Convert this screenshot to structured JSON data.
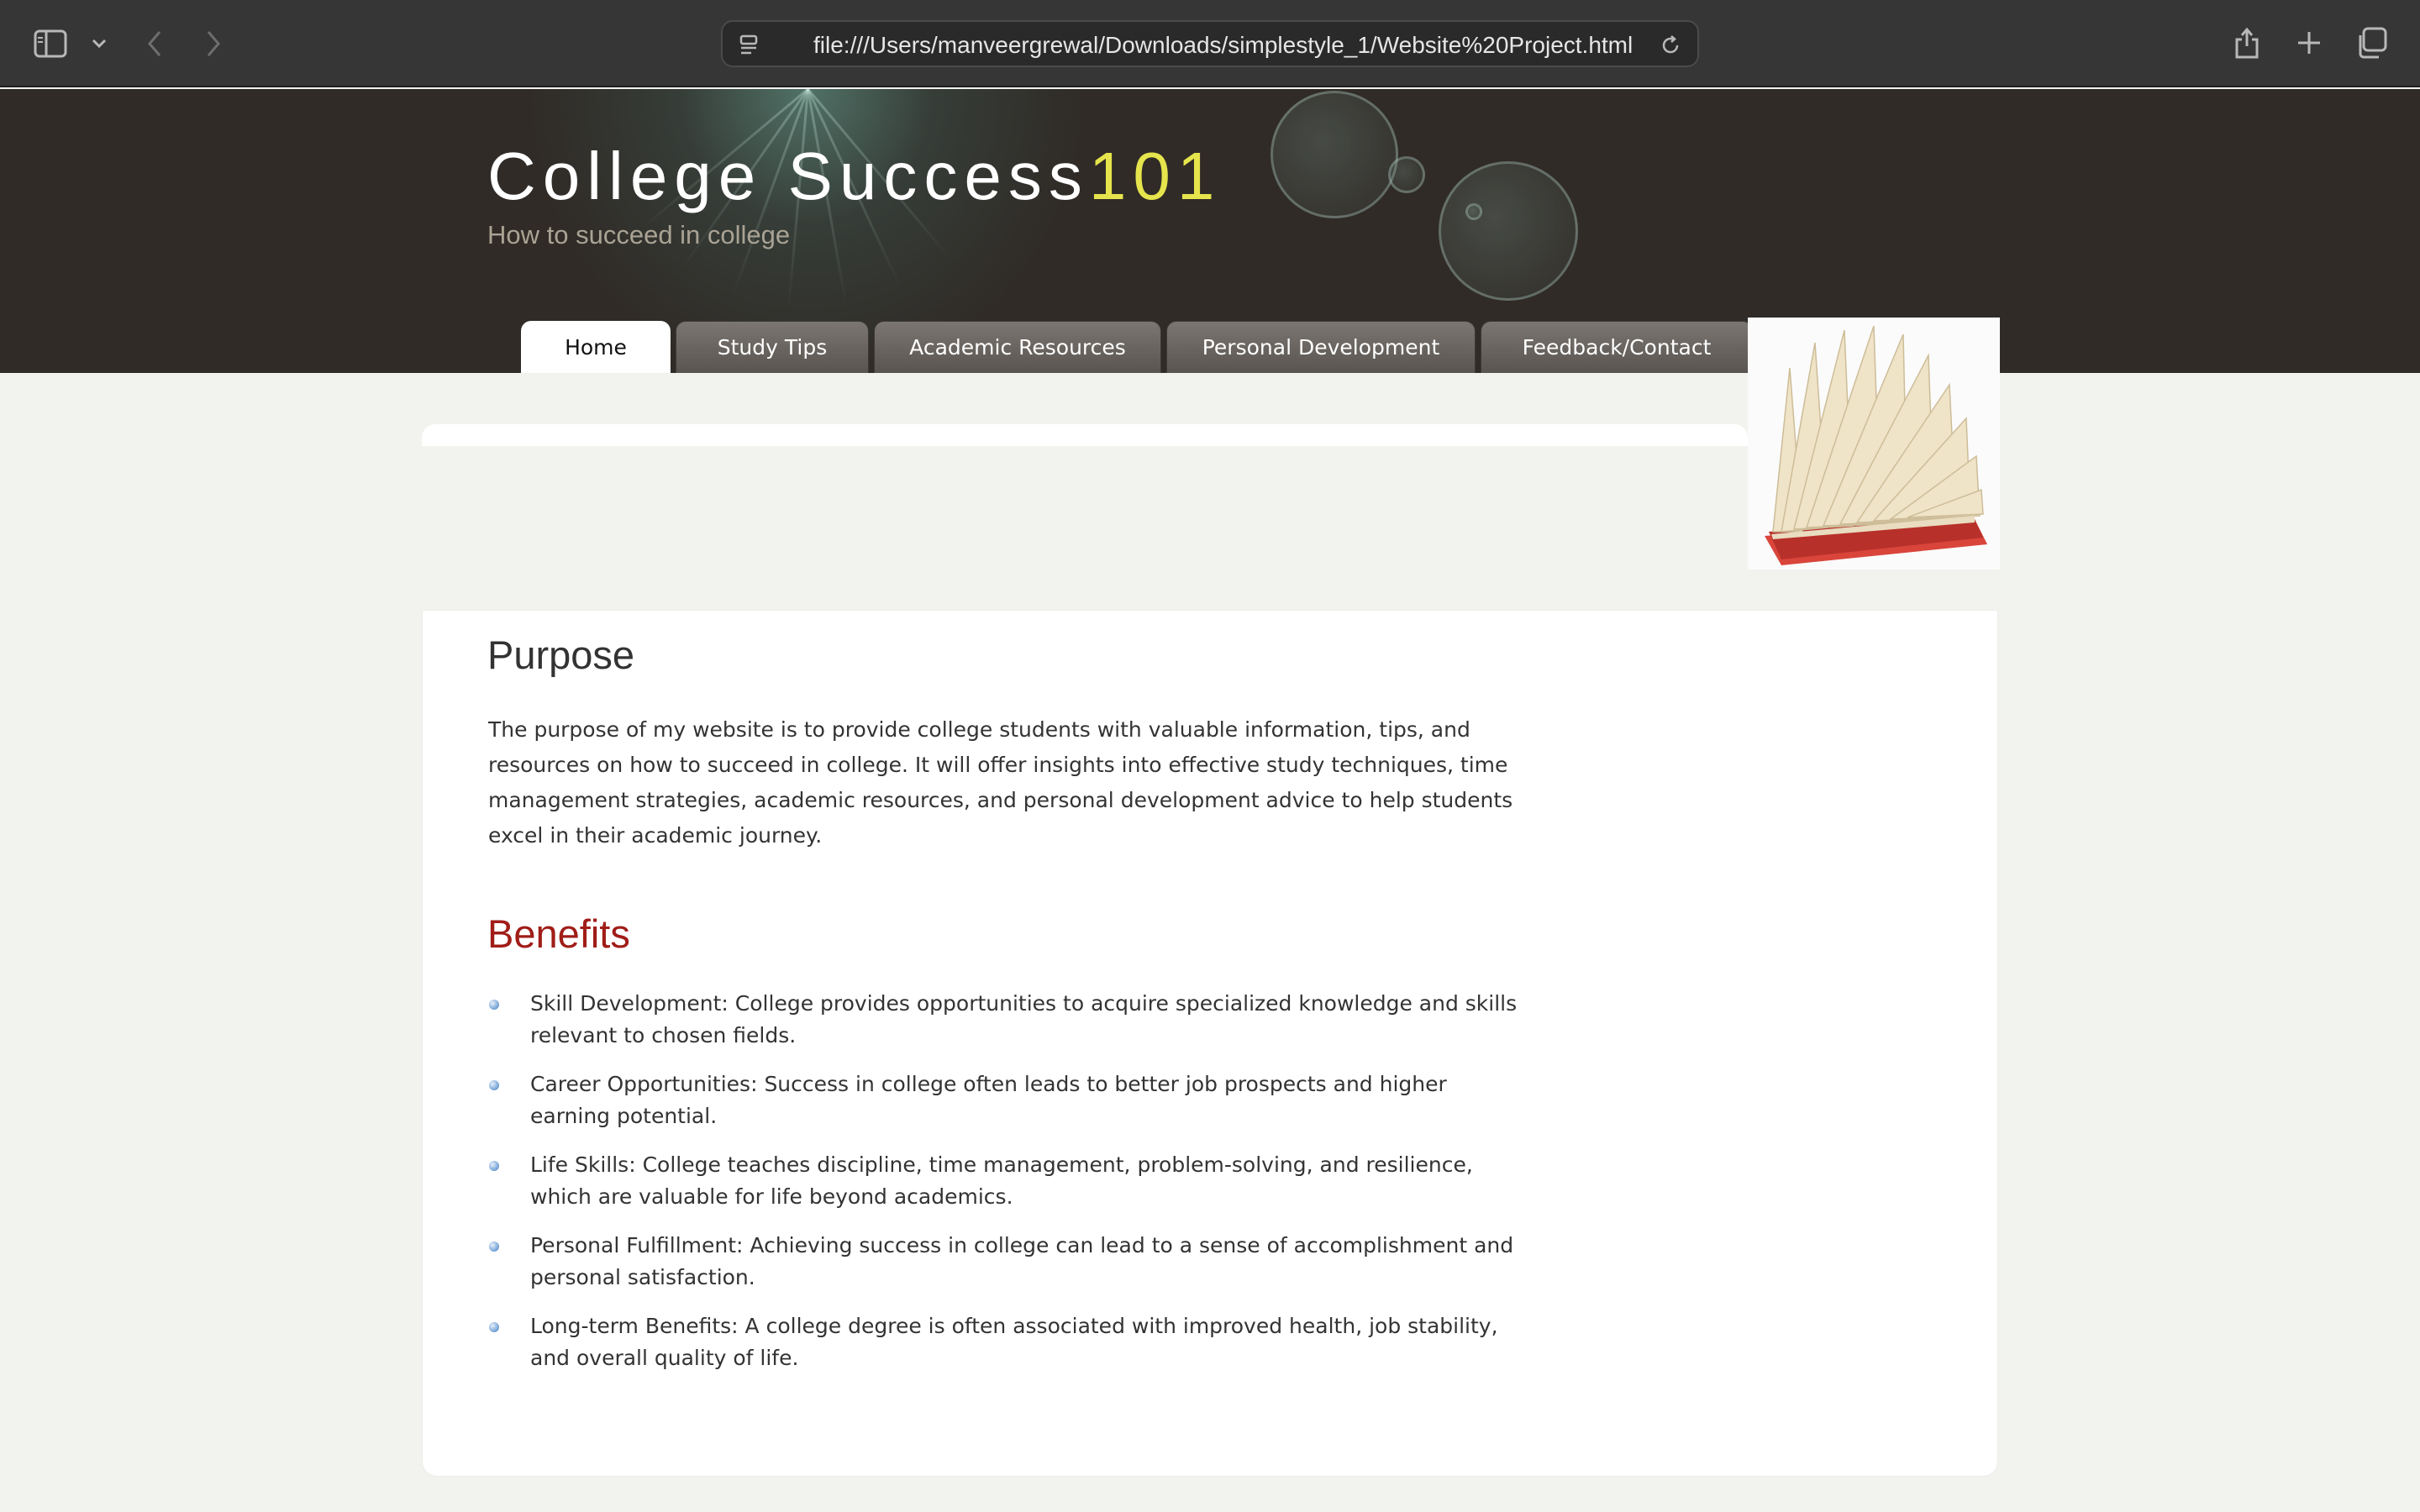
{
  "browser": {
    "url": "file:///Users/manveergrewal/Downloads/simplestyle_1/Website%20Project.html",
    "icons": [
      "sidebar-icon",
      "chevron-down-icon",
      "back-arrow-icon",
      "forward-arrow-icon",
      "page-icon",
      "reload-icon",
      "share-icon",
      "plus-icon",
      "tabs-overview-icon"
    ]
  },
  "site": {
    "title_main": "College Success",
    "title_accent": "101",
    "subtitle": "How to succeed in college",
    "accent_color": "#e6e44c"
  },
  "nav": {
    "items": [
      {
        "label": "Home",
        "active": true
      },
      {
        "label": "Study Tips",
        "active": false
      },
      {
        "label": "Academic Resources",
        "active": false
      },
      {
        "label": "Personal Development",
        "active": false
      },
      {
        "label": "Feedback/Contact",
        "active": false
      }
    ]
  },
  "content": {
    "purpose_heading": "Purpose",
    "purpose_text": "The purpose of my website is to provide college students with valuable information, tips, and resources on how to succeed in college. It will offer insights into effective study techniques, time management strategies, academic resources, and personal development advice to help students excel in their academic journey.",
    "benefits_heading": "Benefits",
    "benefits_color": "#a01d18",
    "benefits": [
      "Skill Development: College provides opportunities to acquire specialized knowledge and skills relevant to chosen fields.",
      "Career Opportunities: Success in college often leads to better job prospects and higher earning potential.",
      "Life Skills: College teaches discipline, time management, problem-solving, and resilience, which are valuable for life beyond academics.",
      "Personal Fulfillment: Achieving success in college can lead to a sense of accomplishment and personal satisfaction.",
      "Long-term Benefits: A college degree is often associated with improved health, job stability, and overall quality of life."
    ]
  }
}
